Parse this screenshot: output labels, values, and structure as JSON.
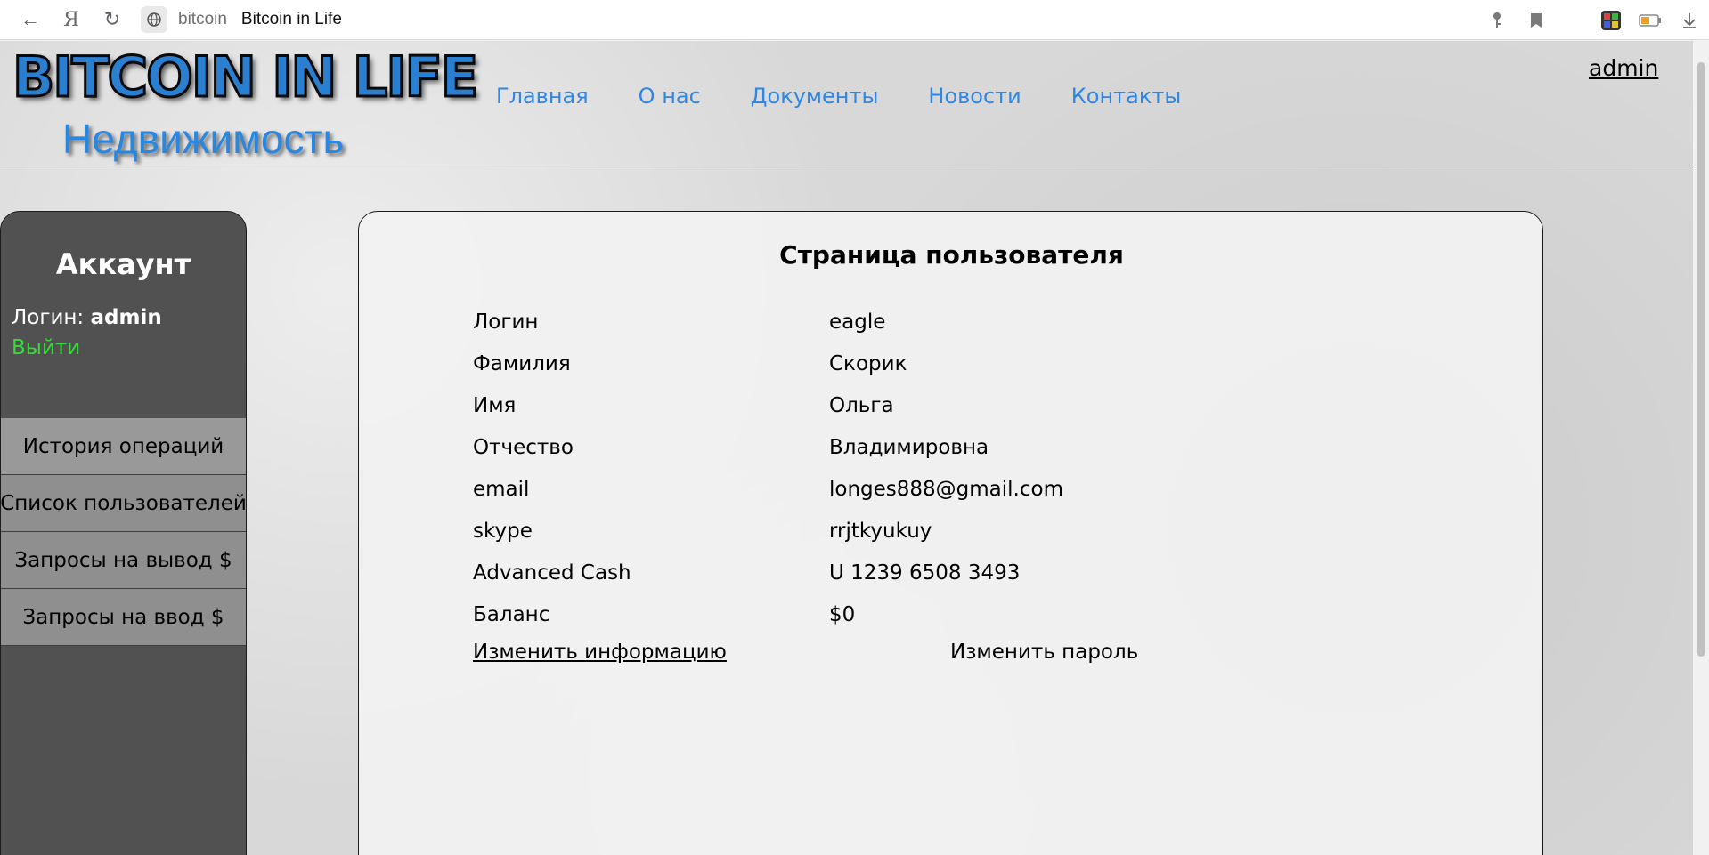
{
  "browser": {
    "back_icon": "←",
    "yandex_icon": "Я",
    "reload_icon": "↻",
    "host": "bitcoin",
    "tab_title": "Bitcoin in Life",
    "icons": [
      "key-icon",
      "bookmark-icon",
      "extension-icon",
      "battery-icon",
      "download-icon"
    ]
  },
  "header": {
    "logo_title": "BITCOIN IN LIFE",
    "logo_subtitle": "Недвижимость",
    "nav": [
      "Главная",
      "О нас",
      "Документы",
      "Новости",
      "Контакты"
    ],
    "user_link": "admin"
  },
  "sidebar": {
    "title": "Аккаунт",
    "login_label": "Логин:",
    "login_value": "admin",
    "logout": "Выйти",
    "items": [
      "История операций",
      "Список пользователей",
      "Запросы на вывод $",
      "Запросы на ввод $"
    ]
  },
  "main": {
    "title": "Страница пользователя",
    "rows": [
      {
        "label": "Логин",
        "value": "eagle"
      },
      {
        "label": "Фамилия",
        "value": "Скорик"
      },
      {
        "label": "Имя",
        "value": "Ольга"
      },
      {
        "label": "Отчество",
        "value": "Владимировна"
      },
      {
        "label": "email",
        "value": "longes888@gmail.com"
      },
      {
        "label": "skype",
        "value": "rrjtkyukuy"
      },
      {
        "label": "Advanced Cash",
        "value": "U 1239 6508 3493"
      },
      {
        "label": "Баланс",
        "value": "$0"
      }
    ],
    "edit_info": "Изменить информацию",
    "change_password": "Изменить пароль"
  },
  "colors": {
    "accent_link": "#2e86e6",
    "logout_green": "#39d839",
    "sidebar_bg": "#515151",
    "sidebar_item_bg": "#8f8f8f"
  }
}
